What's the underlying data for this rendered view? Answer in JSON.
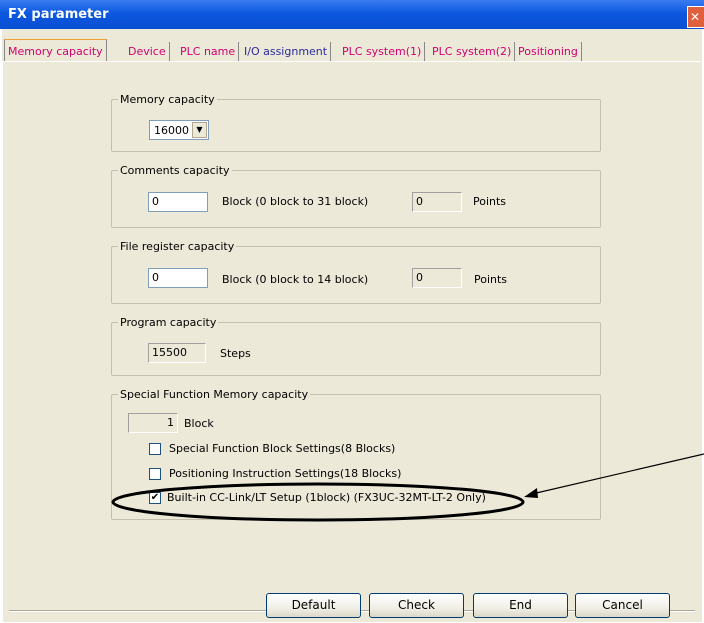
{
  "window": {
    "title": "FX parameter",
    "close_glyph": "✕"
  },
  "tabs": [
    {
      "label": "Memory capacity",
      "active": true
    },
    {
      "label": "Device"
    },
    {
      "label": "PLC name"
    },
    {
      "label": "I/O assignment"
    },
    {
      "label": "PLC system(1)"
    },
    {
      "label": "PLC system(2)"
    },
    {
      "label": "Positioning"
    }
  ],
  "memory": {
    "label": "Memory capacity",
    "selected": "16000"
  },
  "comments": {
    "label": "Comments capacity",
    "value": "0",
    "range": "Block (0 block to 31 block)",
    "points_value": "0",
    "points_label": "Points"
  },
  "file_register": {
    "label": "File register capacity",
    "value": "0",
    "range": "Block (0 block to 14 block)",
    "points_value": "0",
    "points_label": "Points"
  },
  "program": {
    "label": "Program capacity",
    "value": "15500",
    "unit": "Steps"
  },
  "special": {
    "label": "Special Function Memory capacity",
    "blocks_value": "1",
    "blocks_unit": "Block",
    "checkboxes": [
      {
        "label": "Special Function Block Settings(8 Blocks)",
        "checked": false
      },
      {
        "label": "Positioning Instruction Settings(18 Blocks)",
        "checked": false
      },
      {
        "label": "Built-in CC-Link/LT Setup (1block) (FX3UC-32MT-LT-2 Only)",
        "checked": true
      }
    ]
  },
  "buttons": {
    "default": "Default",
    "check": "Check",
    "end": "End",
    "cancel": "Cancel"
  },
  "colors": {
    "titlebar": "#0c58e0",
    "tab_text": "#d0006f",
    "tab_text_alt": "#2a2aa0"
  }
}
